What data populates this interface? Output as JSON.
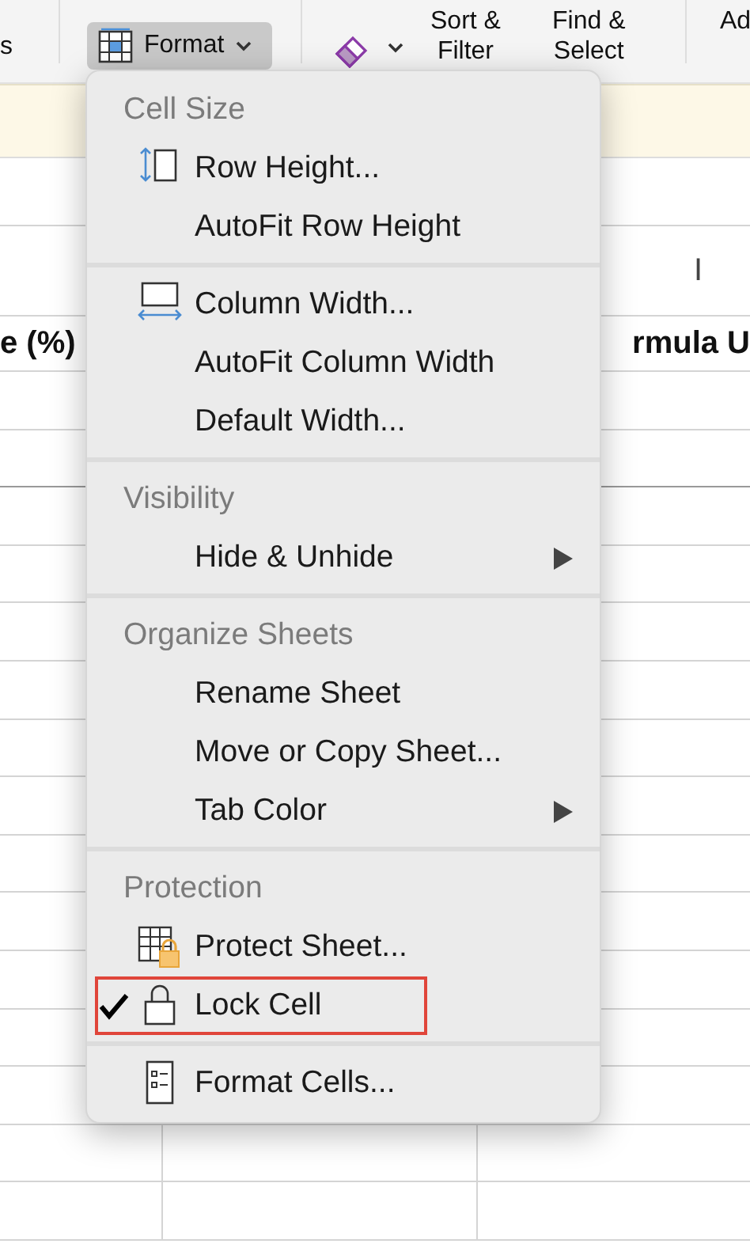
{
  "ribbon": {
    "left_label": "s",
    "format_button": {
      "label": "Format"
    },
    "buttons": [
      {
        "lines": [
          "Sort &",
          "Filter"
        ]
      },
      {
        "lines": [
          "Find &",
          "Select"
        ]
      }
    ],
    "right_label": "Ad"
  },
  "sheet": {
    "column_marker": "I",
    "headers": [
      "e (%)",
      "rmula U"
    ]
  },
  "menu": {
    "sections": [
      {
        "title": "Cell Size",
        "items": [
          {
            "label": "Row Height...",
            "kind": "row-height",
            "checked": false,
            "submenu": false,
            "highlighted": false
          },
          {
            "label": "AutoFit Row Height",
            "checked": false,
            "submenu": false,
            "highlighted": false
          }
        ]
      },
      {
        "items": [
          {
            "label": "Column Width...",
            "kind": "column-width",
            "checked": false,
            "submenu": false,
            "highlighted": false
          },
          {
            "label": "AutoFit Column Width",
            "checked": false,
            "submenu": false,
            "highlighted": false
          },
          {
            "label": "Default Width...",
            "checked": false,
            "submenu": false,
            "highlighted": false
          }
        ]
      },
      {
        "title": "Visibility",
        "items": [
          {
            "label": "Hide & Unhide",
            "checked": false,
            "submenu": true,
            "highlighted": false
          }
        ]
      },
      {
        "title": "Organize Sheets",
        "items": [
          {
            "label": "Rename Sheet",
            "checked": false,
            "submenu": false,
            "highlighted": false
          },
          {
            "label": "Move or Copy Sheet...",
            "checked": false,
            "submenu": false,
            "highlighted": false
          },
          {
            "label": "Tab Color",
            "checked": false,
            "submenu": true,
            "highlighted": false
          }
        ]
      },
      {
        "title": "Protection",
        "items": [
          {
            "label": "Protect Sheet...",
            "kind": "protect-sheet",
            "checked": false,
            "submenu": false,
            "highlighted": false
          },
          {
            "label": "Lock Cell",
            "kind": "lock",
            "checked": true,
            "submenu": false,
            "highlighted": true
          }
        ]
      },
      {
        "items": [
          {
            "label": "Format Cells...",
            "kind": "format-cells",
            "checked": false,
            "submenu": false,
            "highlighted": false
          }
        ]
      }
    ]
  }
}
